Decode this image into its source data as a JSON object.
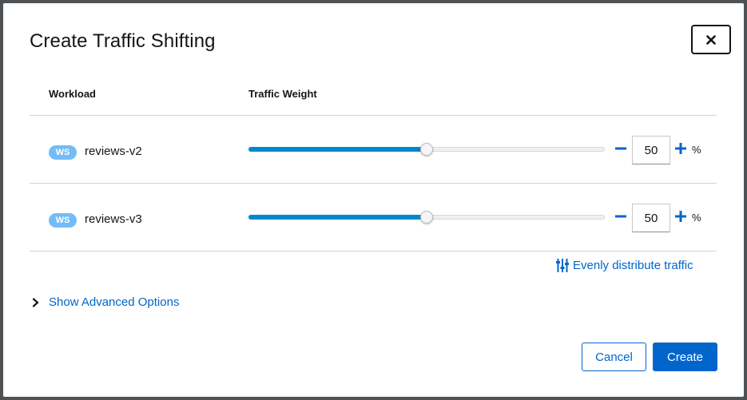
{
  "modal": {
    "title": "Create Traffic Shifting",
    "close_icon": "close-icon"
  },
  "table": {
    "headers": {
      "workload": "Workload",
      "weight": "Traffic Weight"
    },
    "rows": [
      {
        "badge": "WS",
        "name": "reviews-v2",
        "weight": "50",
        "weight_fraction": 0.5,
        "unit": "%"
      },
      {
        "badge": "WS",
        "name": "reviews-v3",
        "weight": "50",
        "weight_fraction": 0.5,
        "unit": "%"
      }
    ]
  },
  "actions": {
    "evenly_distribute": "Evenly distribute traffic",
    "evenly_icon": "sliders-icon",
    "advanced": "Show Advanced Options",
    "advanced_icon": "chevron-right-icon",
    "cancel": "Cancel",
    "create": "Create"
  },
  "colors": {
    "accent": "#0066cc",
    "slider_fill": "#0088ce",
    "badge": "#73bcf7"
  }
}
